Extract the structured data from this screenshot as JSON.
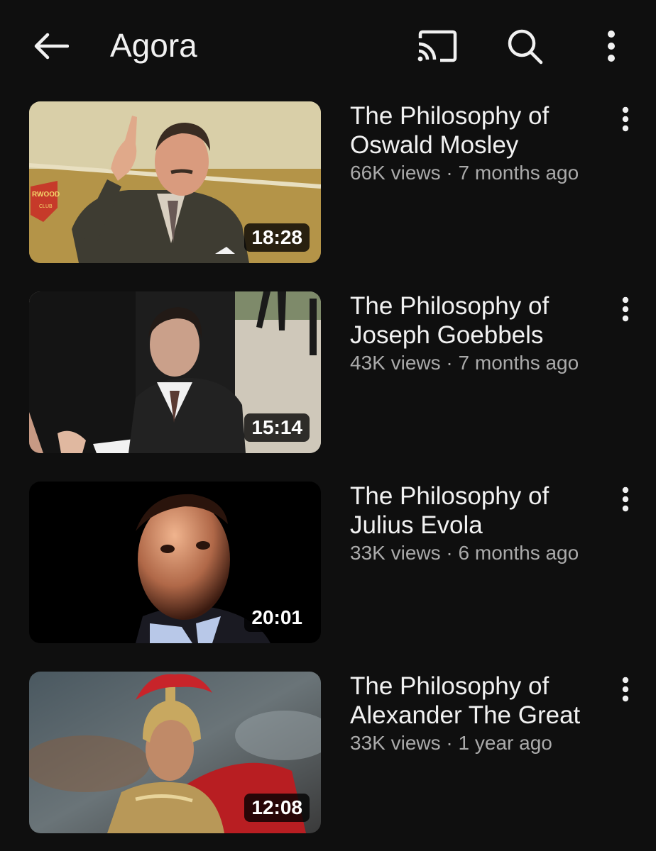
{
  "header": {
    "title": "Agora",
    "icons": [
      "back-arrow-icon",
      "cast-icon",
      "search-icon",
      "more-vertical-icon"
    ]
  },
  "videos": [
    {
      "title_line1": "The Philosophy of",
      "title_line2": "Oswald Mosley",
      "views": "66K views",
      "separator": "·",
      "age": "7 months ago",
      "duration": "18:28",
      "thumb_badge": "RWOOD",
      "thumb_badge_sub": "CLUB"
    },
    {
      "title_line1": "The Philosophy of",
      "title_line2": "Joseph Goebbels",
      "views": "43K views",
      "separator": "·",
      "age": "7 months ago",
      "duration": "15:14"
    },
    {
      "title_line1": "The Philosophy of",
      "title_line2": "Julius Evola",
      "views": "33K views",
      "separator": "·",
      "age": "6 months ago",
      "duration": "20:01"
    },
    {
      "title_line1": "The Philosophy of",
      "title_line2": "Alexander The Great",
      "views": "33K views",
      "separator": "·",
      "age": "1 year ago",
      "duration": "12:08"
    }
  ],
  "colors": {
    "background": "#0f0f0f",
    "text_primary": "#f1f1f1",
    "text_secondary": "#aaaaaa"
  }
}
